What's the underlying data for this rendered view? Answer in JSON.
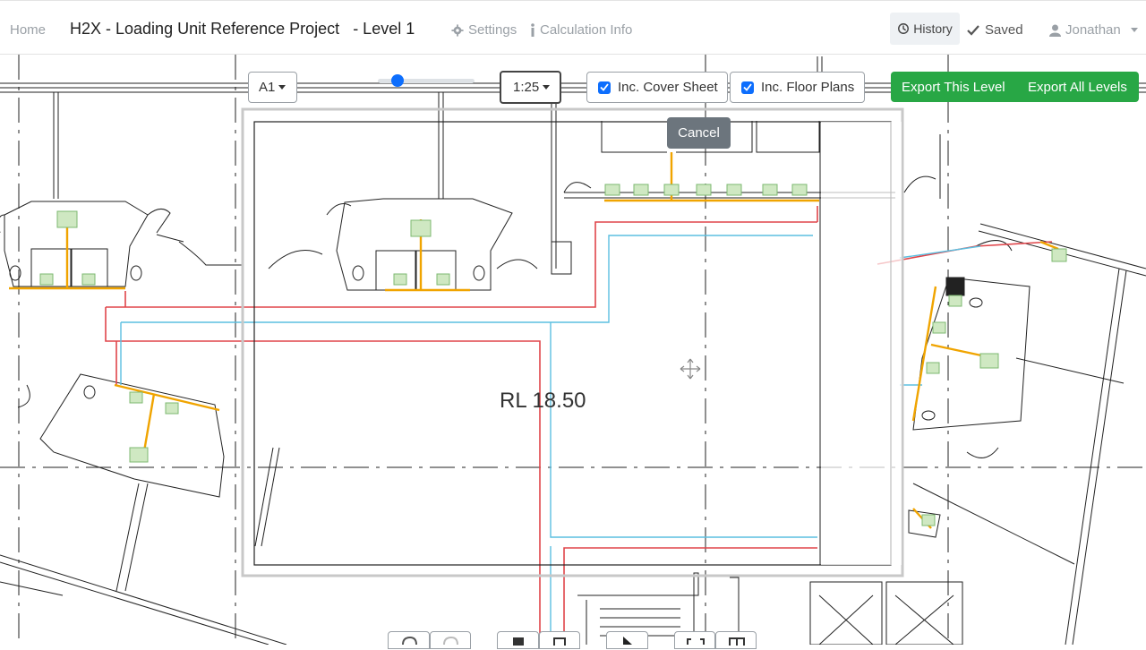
{
  "header": {
    "home": "Home",
    "title": "H2X - Loading Unit Reference Project",
    "level": "- Level 1",
    "settings": "Settings",
    "calc_info": "Calculation Info",
    "history": "History",
    "saved": "Saved",
    "user": "Jonathan"
  },
  "toolbar": {
    "paper_size": "A1",
    "scale": "1:25",
    "zoom_level": 0.2,
    "cover_sheet_label": "Inc. Cover Sheet",
    "cover_sheet_checked": true,
    "floor_plans_label": "Inc. Floor Plans",
    "floor_plans_checked": true,
    "export_level": "Export This Level",
    "export_all": "Export All Levels",
    "cancel": "Cancel"
  },
  "drawing": {
    "rl_label": "RL  18.50"
  },
  "colors": {
    "primary": "#0d6efd",
    "success": "#28a745",
    "secondary": "#6c757d",
    "hot_pipe": "#e0454a",
    "cold_pipe": "#5bbfe0",
    "fixture_pipe": "#f0a400"
  },
  "bottom_toolbar": [
    "undo-icon",
    "redo-icon",
    "copy-icon",
    "paste-icon",
    "select-icon",
    "fit-icon",
    "grid-icon"
  ]
}
